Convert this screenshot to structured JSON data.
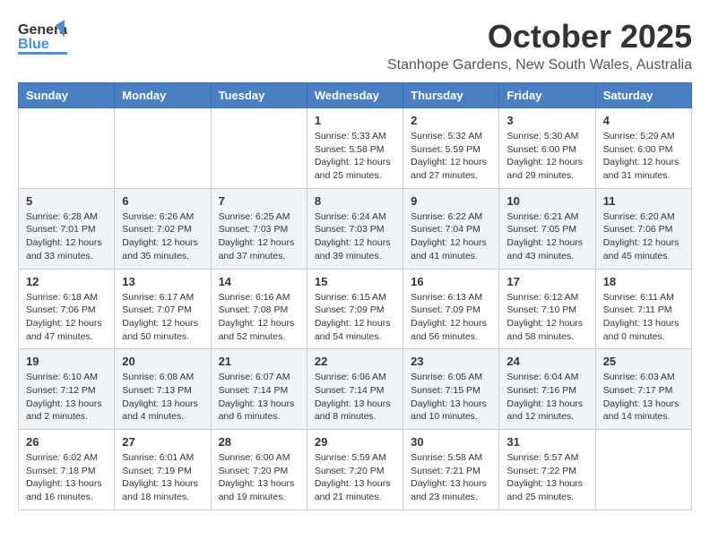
{
  "header": {
    "logo_text_general": "General",
    "logo_text_blue": "Blue",
    "month": "October 2025",
    "location": "Stanhope Gardens, New South Wales, Australia"
  },
  "days_of_week": [
    "Sunday",
    "Monday",
    "Tuesday",
    "Wednesday",
    "Thursday",
    "Friday",
    "Saturday"
  ],
  "weeks": [
    {
      "row_alt": false,
      "days": [
        {
          "number": "",
          "info": ""
        },
        {
          "number": "",
          "info": ""
        },
        {
          "number": "",
          "info": ""
        },
        {
          "number": "1",
          "info": "Sunrise: 5:33 AM\nSunset: 5:58 PM\nDaylight: 12 hours\nand 25 minutes."
        },
        {
          "number": "2",
          "info": "Sunrise: 5:32 AM\nSunset: 5:59 PM\nDaylight: 12 hours\nand 27 minutes."
        },
        {
          "number": "3",
          "info": "Sunrise: 5:30 AM\nSunset: 6:00 PM\nDaylight: 12 hours\nand 29 minutes."
        },
        {
          "number": "4",
          "info": "Sunrise: 5:29 AM\nSunset: 6:00 PM\nDaylight: 12 hours\nand 31 minutes."
        }
      ]
    },
    {
      "row_alt": true,
      "days": [
        {
          "number": "5",
          "info": "Sunrise: 6:28 AM\nSunset: 7:01 PM\nDaylight: 12 hours\nand 33 minutes."
        },
        {
          "number": "6",
          "info": "Sunrise: 6:26 AM\nSunset: 7:02 PM\nDaylight: 12 hours\nand 35 minutes."
        },
        {
          "number": "7",
          "info": "Sunrise: 6:25 AM\nSunset: 7:03 PM\nDaylight: 12 hours\nand 37 minutes."
        },
        {
          "number": "8",
          "info": "Sunrise: 6:24 AM\nSunset: 7:03 PM\nDaylight: 12 hours\nand 39 minutes."
        },
        {
          "number": "9",
          "info": "Sunrise: 6:22 AM\nSunset: 7:04 PM\nDaylight: 12 hours\nand 41 minutes."
        },
        {
          "number": "10",
          "info": "Sunrise: 6:21 AM\nSunset: 7:05 PM\nDaylight: 12 hours\nand 43 minutes."
        },
        {
          "number": "11",
          "info": "Sunrise: 6:20 AM\nSunset: 7:06 PM\nDaylight: 12 hours\nand 45 minutes."
        }
      ]
    },
    {
      "row_alt": false,
      "days": [
        {
          "number": "12",
          "info": "Sunrise: 6:18 AM\nSunset: 7:06 PM\nDaylight: 12 hours\nand 47 minutes."
        },
        {
          "number": "13",
          "info": "Sunrise: 6:17 AM\nSunset: 7:07 PM\nDaylight: 12 hours\nand 50 minutes."
        },
        {
          "number": "14",
          "info": "Sunrise: 6:16 AM\nSunset: 7:08 PM\nDaylight: 12 hours\nand 52 minutes."
        },
        {
          "number": "15",
          "info": "Sunrise: 6:15 AM\nSunset: 7:09 PM\nDaylight: 12 hours\nand 54 minutes."
        },
        {
          "number": "16",
          "info": "Sunrise: 6:13 AM\nSunset: 7:09 PM\nDaylight: 12 hours\nand 56 minutes."
        },
        {
          "number": "17",
          "info": "Sunrise: 6:12 AM\nSunset: 7:10 PM\nDaylight: 12 hours\nand 58 minutes."
        },
        {
          "number": "18",
          "info": "Sunrise: 6:11 AM\nSunset: 7:11 PM\nDaylight: 13 hours\nand 0 minutes."
        }
      ]
    },
    {
      "row_alt": true,
      "days": [
        {
          "number": "19",
          "info": "Sunrise: 6:10 AM\nSunset: 7:12 PM\nDaylight: 13 hours\nand 2 minutes."
        },
        {
          "number": "20",
          "info": "Sunrise: 6:08 AM\nSunset: 7:13 PM\nDaylight: 13 hours\nand 4 minutes."
        },
        {
          "number": "21",
          "info": "Sunrise: 6:07 AM\nSunset: 7:14 PM\nDaylight: 13 hours\nand 6 minutes."
        },
        {
          "number": "22",
          "info": "Sunrise: 6:06 AM\nSunset: 7:14 PM\nDaylight: 13 hours\nand 8 minutes."
        },
        {
          "number": "23",
          "info": "Sunrise: 6:05 AM\nSunset: 7:15 PM\nDaylight: 13 hours\nand 10 minutes."
        },
        {
          "number": "24",
          "info": "Sunrise: 6:04 AM\nSunset: 7:16 PM\nDaylight: 13 hours\nand 12 minutes."
        },
        {
          "number": "25",
          "info": "Sunrise: 6:03 AM\nSunset: 7:17 PM\nDaylight: 13 hours\nand 14 minutes."
        }
      ]
    },
    {
      "row_alt": false,
      "days": [
        {
          "number": "26",
          "info": "Sunrise: 6:02 AM\nSunset: 7:18 PM\nDaylight: 13 hours\nand 16 minutes."
        },
        {
          "number": "27",
          "info": "Sunrise: 6:01 AM\nSunset: 7:19 PM\nDaylight: 13 hours\nand 18 minutes."
        },
        {
          "number": "28",
          "info": "Sunrise: 6:00 AM\nSunset: 7:20 PM\nDaylight: 13 hours\nand 19 minutes."
        },
        {
          "number": "29",
          "info": "Sunrise: 5:59 AM\nSunset: 7:20 PM\nDaylight: 13 hours\nand 21 minutes."
        },
        {
          "number": "30",
          "info": "Sunrise: 5:58 AM\nSunset: 7:21 PM\nDaylight: 13 hours\nand 23 minutes."
        },
        {
          "number": "31",
          "info": "Sunrise: 5:57 AM\nSunset: 7:22 PM\nDaylight: 13 hours\nand 25 minutes."
        },
        {
          "number": "",
          "info": ""
        }
      ]
    }
  ]
}
